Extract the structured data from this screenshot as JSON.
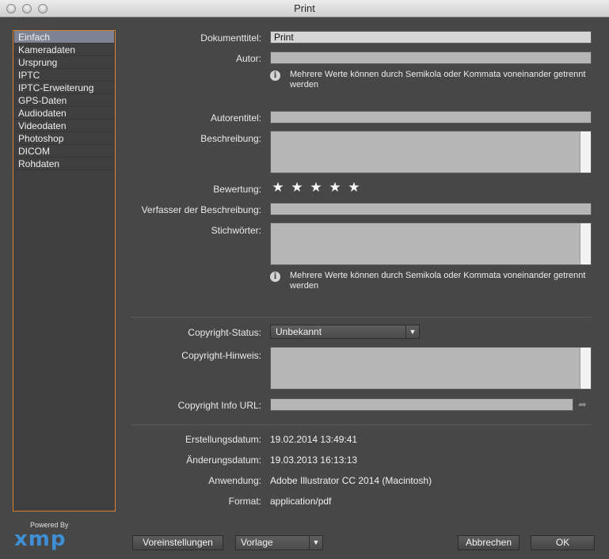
{
  "window": {
    "title": "Print"
  },
  "sidebar": {
    "items": [
      {
        "label": "Einfach"
      },
      {
        "label": "Kameradaten"
      },
      {
        "label": "Ursprung"
      },
      {
        "label": "IPTC"
      },
      {
        "label": "IPTC-Erweiterung"
      },
      {
        "label": "GPS-Daten"
      },
      {
        "label": "Audiodaten"
      },
      {
        "label": "Videodaten"
      },
      {
        "label": "Photoshop"
      },
      {
        "label": "DICOM"
      },
      {
        "label": "Rohdaten"
      }
    ],
    "active": "Einfach"
  },
  "branding": {
    "powered_by": "Powered By",
    "logo": "xmp"
  },
  "form": {
    "dokumenttitel": {
      "label": "Dokumenttitel:",
      "value": "Print"
    },
    "autor": {
      "label": "Autor:",
      "value": ""
    },
    "autor_hint": "Mehrere Werte können durch Semikola oder Kommata voneinander getrennt werden",
    "autorentitel": {
      "label": "Autorentitel:",
      "value": ""
    },
    "beschreibung": {
      "label": "Beschreibung:",
      "value": ""
    },
    "bewertung": {
      "label": "Bewertung:",
      "stars": 5,
      "rating": 0
    },
    "verfasser": {
      "label": "Verfasser der Beschreibung:",
      "value": ""
    },
    "stichwoerter": {
      "label": "Stichwörter:",
      "value": ""
    },
    "stichwoerter_hint": "Mehrere Werte können durch Semikola oder Kommata voneinander getrennt werden",
    "copyright_status": {
      "label": "Copyright-Status:",
      "value": "Unbekannt"
    },
    "copyright_hinweis": {
      "label": "Copyright-Hinweis:",
      "value": ""
    },
    "copyright_url": {
      "label": "Copyright Info URL:",
      "value": ""
    }
  },
  "meta": {
    "erstellungsdatum": {
      "label": "Erstellungsdatum:",
      "value": "19.02.2014 13:49:41"
    },
    "aenderungsdatum": {
      "label": "Änderungsdatum:",
      "value": "19.03.2013 16:13:13"
    },
    "anwendung": {
      "label": "Anwendung:",
      "value": "Adobe Illustrator CC 2014 (Macintosh)"
    },
    "format": {
      "label": "Format:",
      "value": "application/pdf"
    }
  },
  "footer": {
    "voreinstellungen": "Voreinstellungen",
    "vorlage": "Vorlage",
    "abbrechen": "Abbrechen",
    "ok": "OK"
  },
  "colors": {
    "sidebar_border": "#d9822b",
    "active_item": "#7d8392",
    "logo": "#3f8fd6"
  },
  "icons": {
    "info": "info-icon",
    "star": "star-icon",
    "share": "share-arrow-icon",
    "dropdown": "chevron-down-icon"
  }
}
